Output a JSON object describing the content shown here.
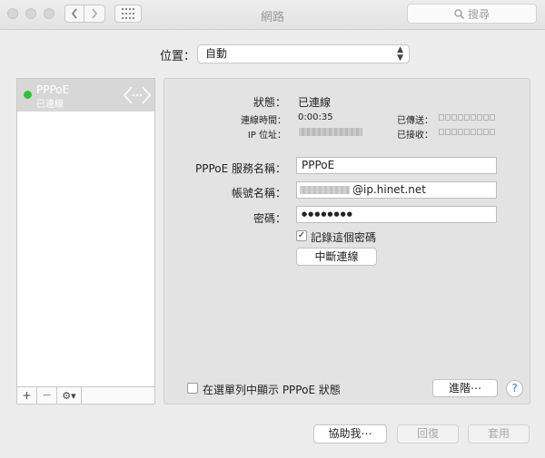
{
  "window": {
    "title": "網路"
  },
  "toolbar": {
    "search_placeholder": "搜尋"
  },
  "location": {
    "label": "位置：",
    "value": "自動"
  },
  "sidebar": {
    "service": {
      "name": "PPPoE",
      "status": "已連線",
      "status_color": "#2fc138"
    },
    "buttons": {
      "add": "+",
      "remove": "—",
      "gear": "⚙▾"
    }
  },
  "panel": {
    "status_label": "狀態：",
    "status_value": "已連線",
    "connect_time_label": "連線時間：",
    "connect_time_value": "0:00:35",
    "ip_label": "IP 位址：",
    "sent_label": "已傳送：",
    "received_label": "已接收：",
    "service_name_label": "PPPoE 服務名稱：",
    "service_name_value": "PPPoE",
    "account_label": "帳號名稱：",
    "account_value": "@ip.hinet.net",
    "password_label": "密碼：",
    "password_value": "●●●●●●●●",
    "remember_label": "記錄這個密碼",
    "remember_checked": "✓",
    "disconnect_button": "中斷連線",
    "menubar_checkbox_label": "在選單列中顯示 PPPoE 狀態",
    "advanced_button": "進階⋯",
    "help": "?"
  },
  "footer": {
    "assist": "協助我⋯",
    "revert": "回復",
    "apply": "套用"
  }
}
